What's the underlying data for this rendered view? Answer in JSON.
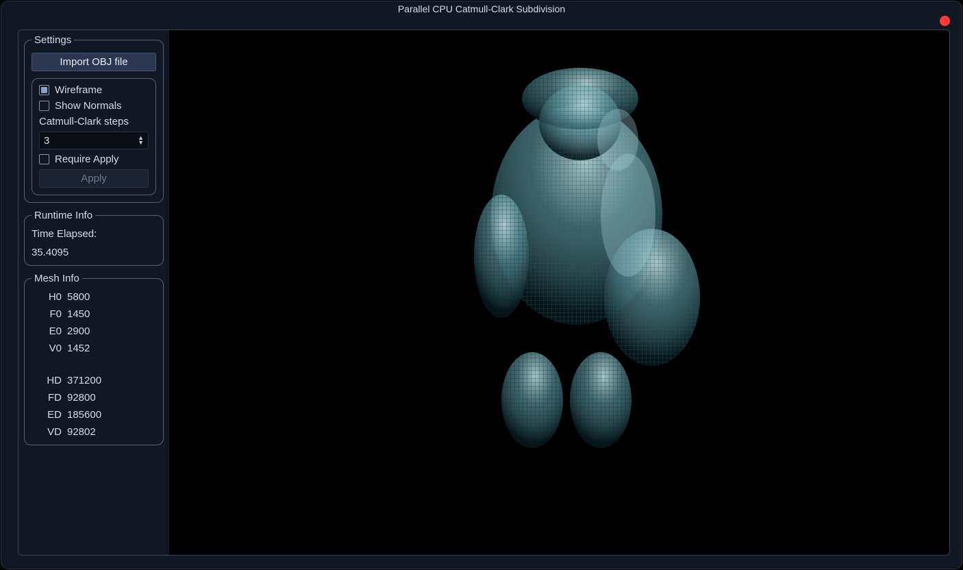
{
  "window": {
    "title": "Parallel CPU Catmull-Clark Subdivision"
  },
  "settings": {
    "legend": "Settings",
    "import_button": "Import OBJ file",
    "wireframe_label": "Wireframe",
    "wireframe_checked": true,
    "show_normals_label": "Show Normals",
    "show_normals_checked": false,
    "steps_label": "Catmull-Clark steps",
    "steps_value": "3",
    "require_apply_label": "Require Apply",
    "require_apply_checked": false,
    "apply_button": "Apply",
    "apply_enabled": false
  },
  "runtime": {
    "legend": "Runtime Info",
    "time_label": "Time Elapsed:",
    "time_value": "35.4095"
  },
  "mesh": {
    "legend": "Mesh Info",
    "rows0": [
      {
        "k": "H0",
        "v": "5800"
      },
      {
        "k": "F0",
        "v": "1450"
      },
      {
        "k": "E0",
        "v": "2900"
      },
      {
        "k": "V0",
        "v": "1452"
      }
    ],
    "rowsD": [
      {
        "k": "HD",
        "v": "371200"
      },
      {
        "k": "FD",
        "v": "92800"
      },
      {
        "k": "ED",
        "v": "185600"
      },
      {
        "k": "VD",
        "v": "92802"
      }
    ]
  }
}
